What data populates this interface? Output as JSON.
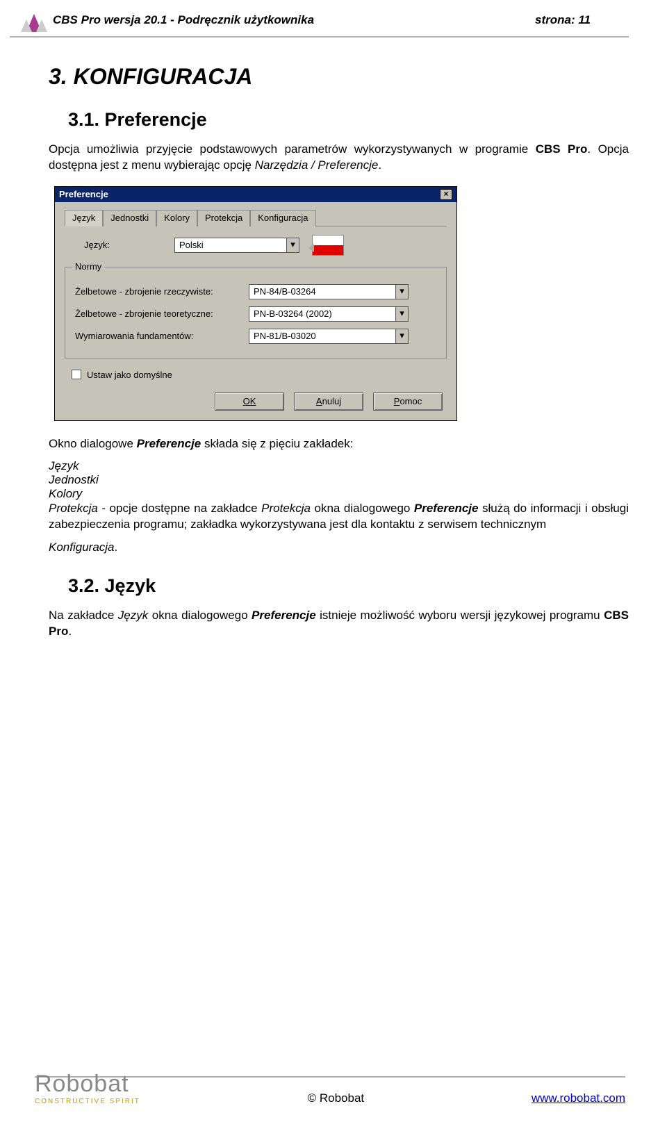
{
  "header": {
    "doc_title": "CBS Pro wersja 20.1 - Podręcznik użytkownika",
    "page_label": "strona: 11"
  },
  "h1": "3. KONFIGURACJA",
  "h2a": "3.1. Preferencje",
  "intro_a": "Opcja umożliwia przyjęcie podstawowych parametrów wykorzystywanych w programie ",
  "intro_b": "CBS Pro",
  "intro_c": ". Opcja dostępna jest z menu wybierając opcję ",
  "intro_d": "Narzędzia / Preferencje",
  "intro_e": ".",
  "dlg": {
    "title": "Preferencje",
    "tabs": [
      "Język",
      "Jednostki",
      "Kolory",
      "Protekcja",
      "Konfiguracja"
    ],
    "lang_label": "Język:",
    "lang_value": "Polski",
    "norms_legend": "Normy",
    "rows": [
      {
        "label": "Żelbetowe - zbrojenie rzeczywiste:",
        "value": "PN-84/B-03264"
      },
      {
        "label": "Żelbetowe - zbrojenie teoretyczne:",
        "value": "PN-B-03264 (2002)"
      },
      {
        "label": "Wymiarowania fundamentów:",
        "value": "PN-81/B-03020"
      }
    ],
    "set_default": "Ustaw jako domyślne",
    "btn_ok": "OK",
    "btn_cancel": "Anuluj",
    "btn_help": "Pomoc"
  },
  "after1_a": "Okno dialogowe ",
  "after1_b": "Preferencje",
  "after1_c": " składa się z pięciu zakładek:",
  "tabs_list": [
    "Język",
    "Jednostki",
    "Kolory"
  ],
  "prot_a": "Protekcja",
  "prot_b": " - opcje dostępne na zakładce ",
  "prot_c": "Protekcja",
  "prot_d": " okna dialogowego ",
  "prot_e": "Preferencje",
  "prot_f": " służą do informacji i obsługi zabezpieczenia programu; zakładka wykorzystywana jest dla kontaktu z serwisem technicznym",
  "konf": "Konfiguracja",
  "h2b": "3.2. Język",
  "lang_p_a": "Na zakładce ",
  "lang_p_b": "Język",
  "lang_p_c": " okna dialogowego ",
  "lang_p_d": "Preferencje",
  "lang_p_e": " istnieje możliwość wyboru wersji językowej programu ",
  "lang_p_f": "CBS Pro",
  "lang_p_g": ".",
  "footer": {
    "brand": "Robobat",
    "tag": "CONSTRUCTIVE SPIRIT",
    "copyright": "© Robobat",
    "link": "www.robobat.com"
  }
}
